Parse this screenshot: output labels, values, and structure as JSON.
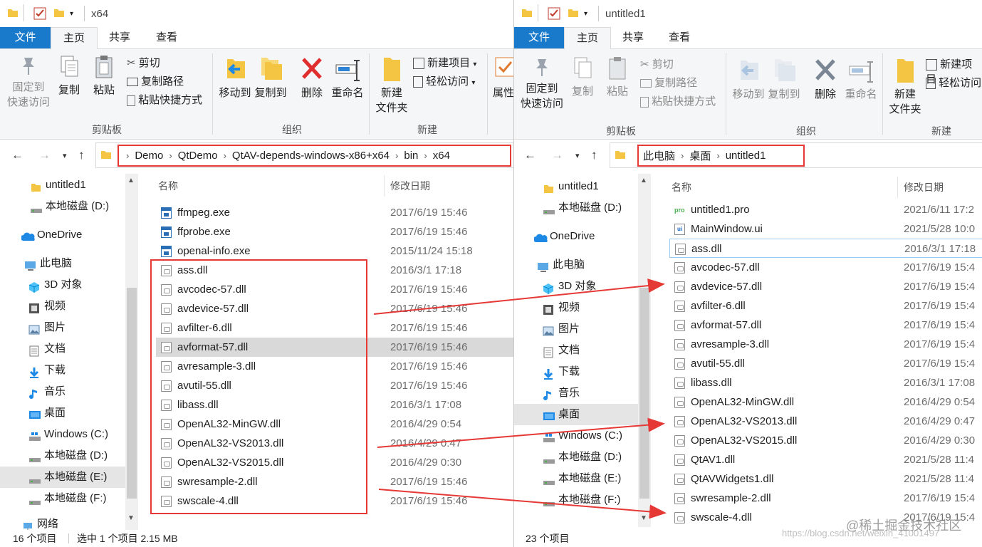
{
  "left_window": {
    "title": "x64",
    "tabs": [
      "文件",
      "主页",
      "共享",
      "查看"
    ],
    "ribbon": {
      "pin": [
        "固定到",
        "快速访问"
      ],
      "copy": "复制",
      "paste": "粘贴",
      "cut": "剪切",
      "copy_path": "复制路径",
      "paste_shortcut": "粘贴快捷方式",
      "move_to": "移动到",
      "copy_to": "复制到",
      "delete": "删除",
      "rename": "重命名",
      "new_folder": [
        "新建",
        "文件夹"
      ],
      "new_item": "新建项目",
      "easy_access": "轻松访问",
      "properties": "属性",
      "group_clipboard": "剪贴板",
      "group_organize": "组织",
      "group_new": "新建"
    },
    "breadcrumbs": [
      "Demo",
      "QtDemo",
      "QtAV-depends-windows-x86+x64",
      "bin",
      "x64"
    ],
    "nav_items": [
      "untitled1",
      "本地磁盘 (D:)",
      "OneDrive",
      "此电脑",
      "3D 对象",
      "视频",
      "图片",
      "文档",
      "下载",
      "音乐",
      "桌面",
      "Windows (C:)",
      "本地磁盘 (D:)",
      "本地磁盘 (E:)",
      "本地磁盘 (F:)",
      "网络"
    ],
    "columns": {
      "name": "名称",
      "date": "修改日期"
    },
    "files": [
      {
        "name": "ffmpeg.exe",
        "date": "2017/6/19 15:46",
        "type": "exe"
      },
      {
        "name": "ffprobe.exe",
        "date": "2017/6/19 15:46",
        "type": "exe"
      },
      {
        "name": "openal-info.exe",
        "date": "2015/11/24 15:18",
        "type": "exe"
      },
      {
        "name": "ass.dll",
        "date": "2016/3/1 17:18",
        "type": "dll"
      },
      {
        "name": "avcodec-57.dll",
        "date": "2017/6/19 15:46",
        "type": "dll"
      },
      {
        "name": "avdevice-57.dll",
        "date": "2017/6/19 15:46",
        "type": "dll"
      },
      {
        "name": "avfilter-6.dll",
        "date": "2017/6/19 15:46",
        "type": "dll"
      },
      {
        "name": "avformat-57.dll",
        "date": "2017/6/19 15:46",
        "type": "dll"
      },
      {
        "name": "avresample-3.dll",
        "date": "2017/6/19 15:46",
        "type": "dll"
      },
      {
        "name": "avutil-55.dll",
        "date": "2017/6/19 15:46",
        "type": "dll"
      },
      {
        "name": "libass.dll",
        "date": "2016/3/1 17:08",
        "type": "dll"
      },
      {
        "name": "OpenAL32-MinGW.dll",
        "date": "2016/4/29 0:54",
        "type": "dll"
      },
      {
        "name": "OpenAL32-VS2013.dll",
        "date": "2016/4/29 0:47",
        "type": "dll"
      },
      {
        "name": "OpenAL32-VS2015.dll",
        "date": "2016/4/29 0:30",
        "type": "dll"
      },
      {
        "name": "swresample-2.dll",
        "date": "2017/6/19 15:46",
        "type": "dll"
      },
      {
        "name": "swscale-4.dll",
        "date": "2017/6/19 15:46",
        "type": "dll"
      }
    ],
    "status": {
      "count": "16 个项目",
      "selection": "选中 1 个项目 2.15 MB"
    }
  },
  "right_window": {
    "title": "untitled1",
    "tabs": [
      "文件",
      "主页",
      "共享",
      "查看"
    ],
    "ribbon": {
      "pin": [
        "固定到",
        "快速访问"
      ],
      "copy": "复制",
      "paste": "粘贴",
      "cut": "剪切",
      "copy_path": "复制路径",
      "paste_shortcut": "粘贴快捷方式",
      "move_to": "移动到",
      "copy_to": "复制到",
      "delete": "删除",
      "rename": "重命名",
      "new_folder": [
        "新建",
        "文件夹"
      ],
      "new_item": "新建项目",
      "easy_access": "轻松访问",
      "group_clipboard": "剪贴板",
      "group_organize": "组织",
      "group_new": "新建"
    },
    "breadcrumbs": [
      "此电脑",
      "桌面",
      "untitled1"
    ],
    "nav_items": [
      "untitled1",
      "本地磁盘 (D:)",
      "OneDrive",
      "此电脑",
      "3D 对象",
      "视频",
      "图片",
      "文档",
      "下载",
      "音乐",
      "桌面",
      "Windows (C:)",
      "本地磁盘 (D:)",
      "本地磁盘 (E:)",
      "本地磁盘 (F:)"
    ],
    "columns": {
      "name": "名称",
      "date": "修改日期"
    },
    "files": [
      {
        "name": "untitled1.pro",
        "date": "2021/6/11 17:2",
        "type": "pro"
      },
      {
        "name": "MainWindow.ui",
        "date": "2021/5/28 10:0",
        "type": "ui"
      },
      {
        "name": "ass.dll",
        "date": "2016/3/1 17:18",
        "type": "dll"
      },
      {
        "name": "avcodec-57.dll",
        "date": "2017/6/19 15:4",
        "type": "dll"
      },
      {
        "name": "avdevice-57.dll",
        "date": "2017/6/19 15:4",
        "type": "dll"
      },
      {
        "name": "avfilter-6.dll",
        "date": "2017/6/19 15:4",
        "type": "dll"
      },
      {
        "name": "avformat-57.dll",
        "date": "2017/6/19 15:4",
        "type": "dll"
      },
      {
        "name": "avresample-3.dll",
        "date": "2017/6/19 15:4",
        "type": "dll"
      },
      {
        "name": "avutil-55.dll",
        "date": "2017/6/19 15:4",
        "type": "dll"
      },
      {
        "name": "libass.dll",
        "date": "2016/3/1 17:08",
        "type": "dll"
      },
      {
        "name": "OpenAL32-MinGW.dll",
        "date": "2016/4/29 0:54",
        "type": "dll"
      },
      {
        "name": "OpenAL32-VS2013.dll",
        "date": "2016/4/29 0:47",
        "type": "dll"
      },
      {
        "name": "OpenAL32-VS2015.dll",
        "date": "2016/4/29 0:30",
        "type": "dll"
      },
      {
        "name": "QtAV1.dll",
        "date": "2021/5/28 11:4",
        "type": "dll"
      },
      {
        "name": "QtAVWidgets1.dll",
        "date": "2021/5/28 11:4",
        "type": "dll"
      },
      {
        "name": "swresample-2.dll",
        "date": "2017/6/19 15:4",
        "type": "dll"
      },
      {
        "name": "swscale-4.dll",
        "date": "2017/6/19 15:4",
        "type": "dll"
      }
    ],
    "status": {
      "count": "23 个项目"
    }
  },
  "watermark": {
    "url": "https://blog.csdn.net/weixin_41001497",
    "brand": "@稀土掘金技术社区"
  },
  "colors": {
    "accent": "#1979ca",
    "highlight": "#e53935",
    "selection": "#d9d9d9"
  }
}
